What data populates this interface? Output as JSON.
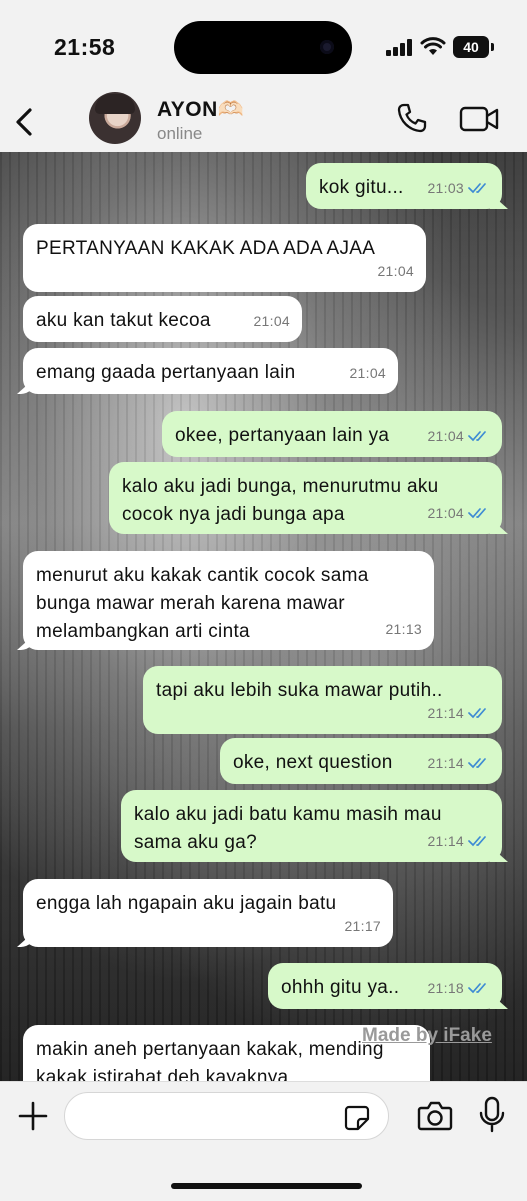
{
  "status_bar": {
    "time": "21:58",
    "battery": "40"
  },
  "header": {
    "name": "AYON🫶🏻",
    "status": "online"
  },
  "messages": [
    {
      "side": "out",
      "text": "kok gitu...",
      "time": "21:03"
    },
    {
      "side": "in",
      "text": "PERTANYAAN KAKAK ADA ADA AJAA",
      "time": "21:04"
    },
    {
      "side": "in",
      "text": "aku kan takut kecoa",
      "time": "21:04"
    },
    {
      "side": "in",
      "text": "emang gaada pertanyaan lain",
      "time": "21:04"
    },
    {
      "side": "out",
      "text": "okee, pertanyaan lain ya",
      "time": "21:04"
    },
    {
      "side": "out",
      "text": "kalo aku jadi bunga, menurutmu aku cocok nya jadi bunga apa",
      "time": "21:04"
    },
    {
      "side": "in",
      "text": "menurut aku kakak cantik cocok sama bunga mawar merah karena mawar melambangkan arti cinta",
      "time": "21:13"
    },
    {
      "side": "out",
      "text": "tapi aku lebih suka mawar putih..",
      "time": "21:14"
    },
    {
      "side": "out",
      "text": "oke, next question",
      "time": "21:14"
    },
    {
      "side": "out",
      "text": "kalo aku jadi batu kamu masih mau sama aku ga?",
      "time": "21:14"
    },
    {
      "side": "in",
      "text": "engga lah ngapain aku jagain batu",
      "time": "21:17"
    },
    {
      "side": "out",
      "text": "ohhh gitu ya..",
      "time": "21:18"
    },
    {
      "side": "in",
      "text": "makin aneh pertanyaan kakak, mending kakak istirahat deh kayaknya",
      "time": ""
    }
  ],
  "watermark": "Made by iFake",
  "colors": {
    "outgoing_bubble": "#d7f9c9",
    "incoming_bubble": "#ffffff",
    "read_ticks": "#3d8bd4"
  }
}
